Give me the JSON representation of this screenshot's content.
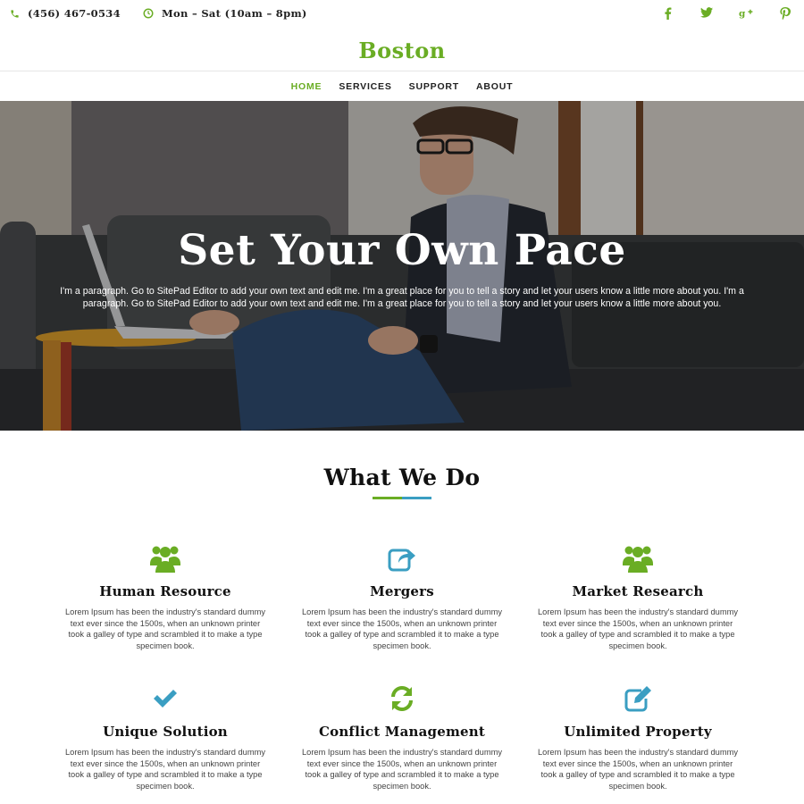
{
  "topbar": {
    "phone": "(456) 467-0534",
    "hours": "Mon – Sat (10am – 8pm)",
    "social": [
      "facebook-icon",
      "twitter-icon",
      "google-plus-icon",
      "pinterest-icon"
    ]
  },
  "brand": {
    "name": "Boston"
  },
  "nav": {
    "items": [
      {
        "label": "HOME",
        "active": true
      },
      {
        "label": "SERVICES"
      },
      {
        "label": "SUPPORT"
      },
      {
        "label": "ABOUT"
      }
    ]
  },
  "hero": {
    "title": "Set Your Own Pace",
    "text": "I'm a paragraph. Go to SitePad Editor to add your own text and edit me. I'm a great place for you to tell a story and let your users know a little more about you. I'm a paragraph. Go to SitePad Editor to add your own text and edit me. I'm a great place for you to tell a story and let your users know a little more about you."
  },
  "services": {
    "title": "What We Do",
    "items": [
      {
        "title": "Human Resource",
        "icon": "users-icon",
        "text": "Lorem Ipsum has been the industry's standard dummy text ever since the 1500s, when an unknown printer took a galley of type and scrambled it to make a type specimen book."
      },
      {
        "title": "Mergers",
        "icon": "share-icon",
        "text": "Lorem Ipsum has been the industry's standard dummy text ever since the 1500s, when an unknown printer took a galley of type and scrambled it to make a type specimen book."
      },
      {
        "title": "Market Research",
        "icon": "users-icon",
        "text": "Lorem Ipsum has been the industry's standard dummy text ever since the 1500s, when an unknown printer took a galley of type and scrambled it to make a type specimen book."
      },
      {
        "title": "Unique Solution",
        "icon": "checkmark-icon",
        "text": "Lorem Ipsum has been the industry's standard dummy text ever since the 1500s, when an unknown printer took a galley of type and scrambled it to make a type specimen book."
      },
      {
        "title": "Conflict Management",
        "icon": "refresh-icon",
        "text": "Lorem Ipsum has been the industry's standard dummy text ever since the 1500s, when an unknown printer took a galley of type and scrambled it to make a type specimen book."
      },
      {
        "title": "Unlimited Property",
        "icon": "edit-icon",
        "text": "Lorem Ipsum has been the industry's standard dummy text ever since the 1500s, when an unknown printer took a galley of type and scrambled it to make a type specimen book."
      }
    ]
  },
  "colors": {
    "accent_green": "#6aad24",
    "accent_blue": "#3a9ec2"
  }
}
